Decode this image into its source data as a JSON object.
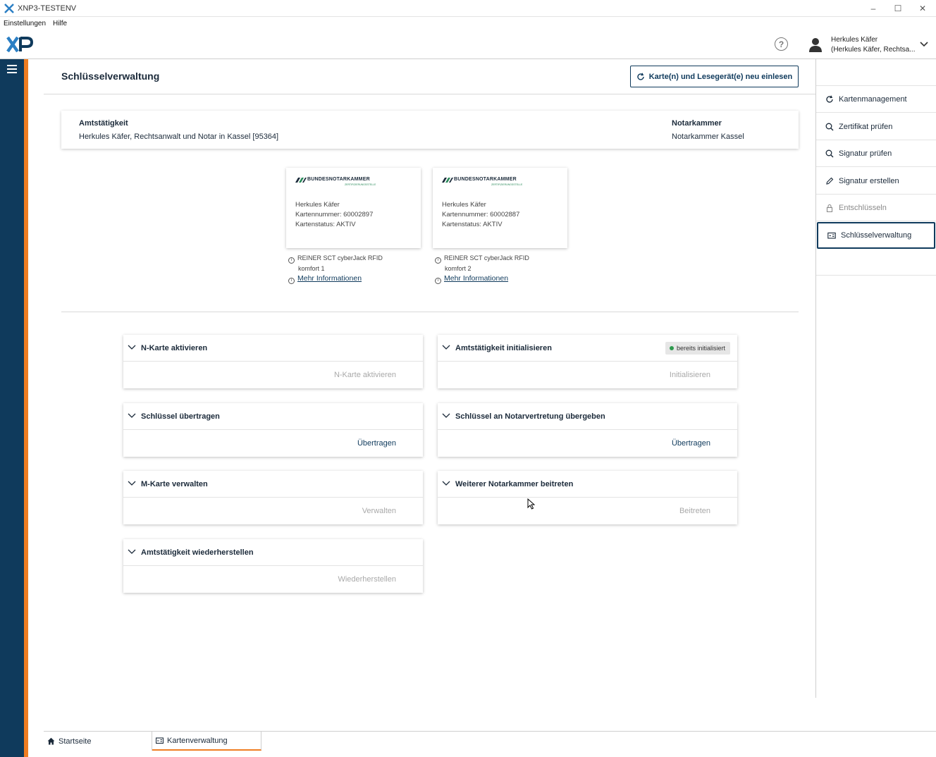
{
  "window": {
    "title": "XNP3-TESTENV",
    "minimize": "–",
    "maximize": "☐",
    "close": "✕"
  },
  "menu": {
    "items": [
      "Einstellungen",
      "Hilfe"
    ]
  },
  "header": {
    "logo_text": "XP",
    "help_symbol": "?",
    "user_name": "Herkules Käfer",
    "user_role": "(Herkules Käfer, Rechtsa..."
  },
  "page": {
    "title": "Schlüsselverwaltung",
    "reload_button": "Karte(n) und Lesegerät(e) neu einlesen"
  },
  "office": {
    "label": "Amtstätigkeit",
    "value": "Herkules Käfer, Rechtsanwalt und Notar in Kassel [95364]",
    "chamber_label": "Notarkammer",
    "chamber_value": "Notarkammer Kassel"
  },
  "cards": [
    {
      "issuer": "BUNDESNOTARKAMMER",
      "issuer_sub": "ZERTIFIZIERUNGSSTELLE",
      "holder": "Herkules Käfer",
      "number": "Kartennummer: 60002897",
      "status": "Kartenstatus: AKTIV",
      "reader_line1": "REINER SCT cyberJack RFID",
      "reader_line2": "komfort 1",
      "more_info": "Mehr Informationen"
    },
    {
      "issuer": "BUNDESNOTARKAMMER",
      "issuer_sub": "ZERTIFIZIERUNGSSTELLE",
      "holder": "Herkules Käfer",
      "number": "Kartennummer: 60002887",
      "status": "Kartenstatus: AKTIV",
      "reader_line1": "REINER SCT cyberJack RFID",
      "reader_line2": "komfort 2",
      "more_info": "Mehr Informationen"
    }
  ],
  "panels": [
    {
      "title": "N-Karte aktivieren",
      "action": "N-Karte aktivieren",
      "enabled": false
    },
    {
      "title": "Amtstätigkeit initialisieren",
      "action": "Initialisieren",
      "enabled": false,
      "badge": "bereits initialisiert"
    },
    {
      "title": "Schlüssel übertragen",
      "action": "Übertragen",
      "enabled": true
    },
    {
      "title": "Schlüssel an Notarvertretung übergeben",
      "action": "Übertragen",
      "enabled": true
    },
    {
      "title": "M-Karte verwalten",
      "action": "Verwalten",
      "enabled": false
    },
    {
      "title": "Weiterer Notarkammer beitreten",
      "action": "Beitreten",
      "enabled": false
    },
    {
      "title": "Amtstätigkeit wiederherstellen",
      "action": "Wiederherstellen",
      "enabled": false
    }
  ],
  "rightnav": {
    "items": [
      {
        "label": "Kartenmanagement",
        "icon": "refresh-icon"
      },
      {
        "label": "Zertifikat prüfen",
        "icon": "search-icon"
      },
      {
        "label": "Signatur prüfen",
        "icon": "search-icon"
      },
      {
        "label": "Signatur erstellen",
        "icon": "pen-icon"
      },
      {
        "label": "Entschlüsseln",
        "icon": "lock-icon",
        "disabled": true
      },
      {
        "label": "Schlüsselverwaltung",
        "icon": "key-card-icon",
        "active": true
      }
    ]
  },
  "bottom_tabs": [
    {
      "label": "Startseite",
      "icon": "home-icon"
    },
    {
      "label": "Kartenverwaltung",
      "icon": "card-icon",
      "active": true
    }
  ],
  "colors": {
    "brand": "#0f3a5c",
    "accent": "#ef7d22",
    "success": "#2e9a4e"
  }
}
